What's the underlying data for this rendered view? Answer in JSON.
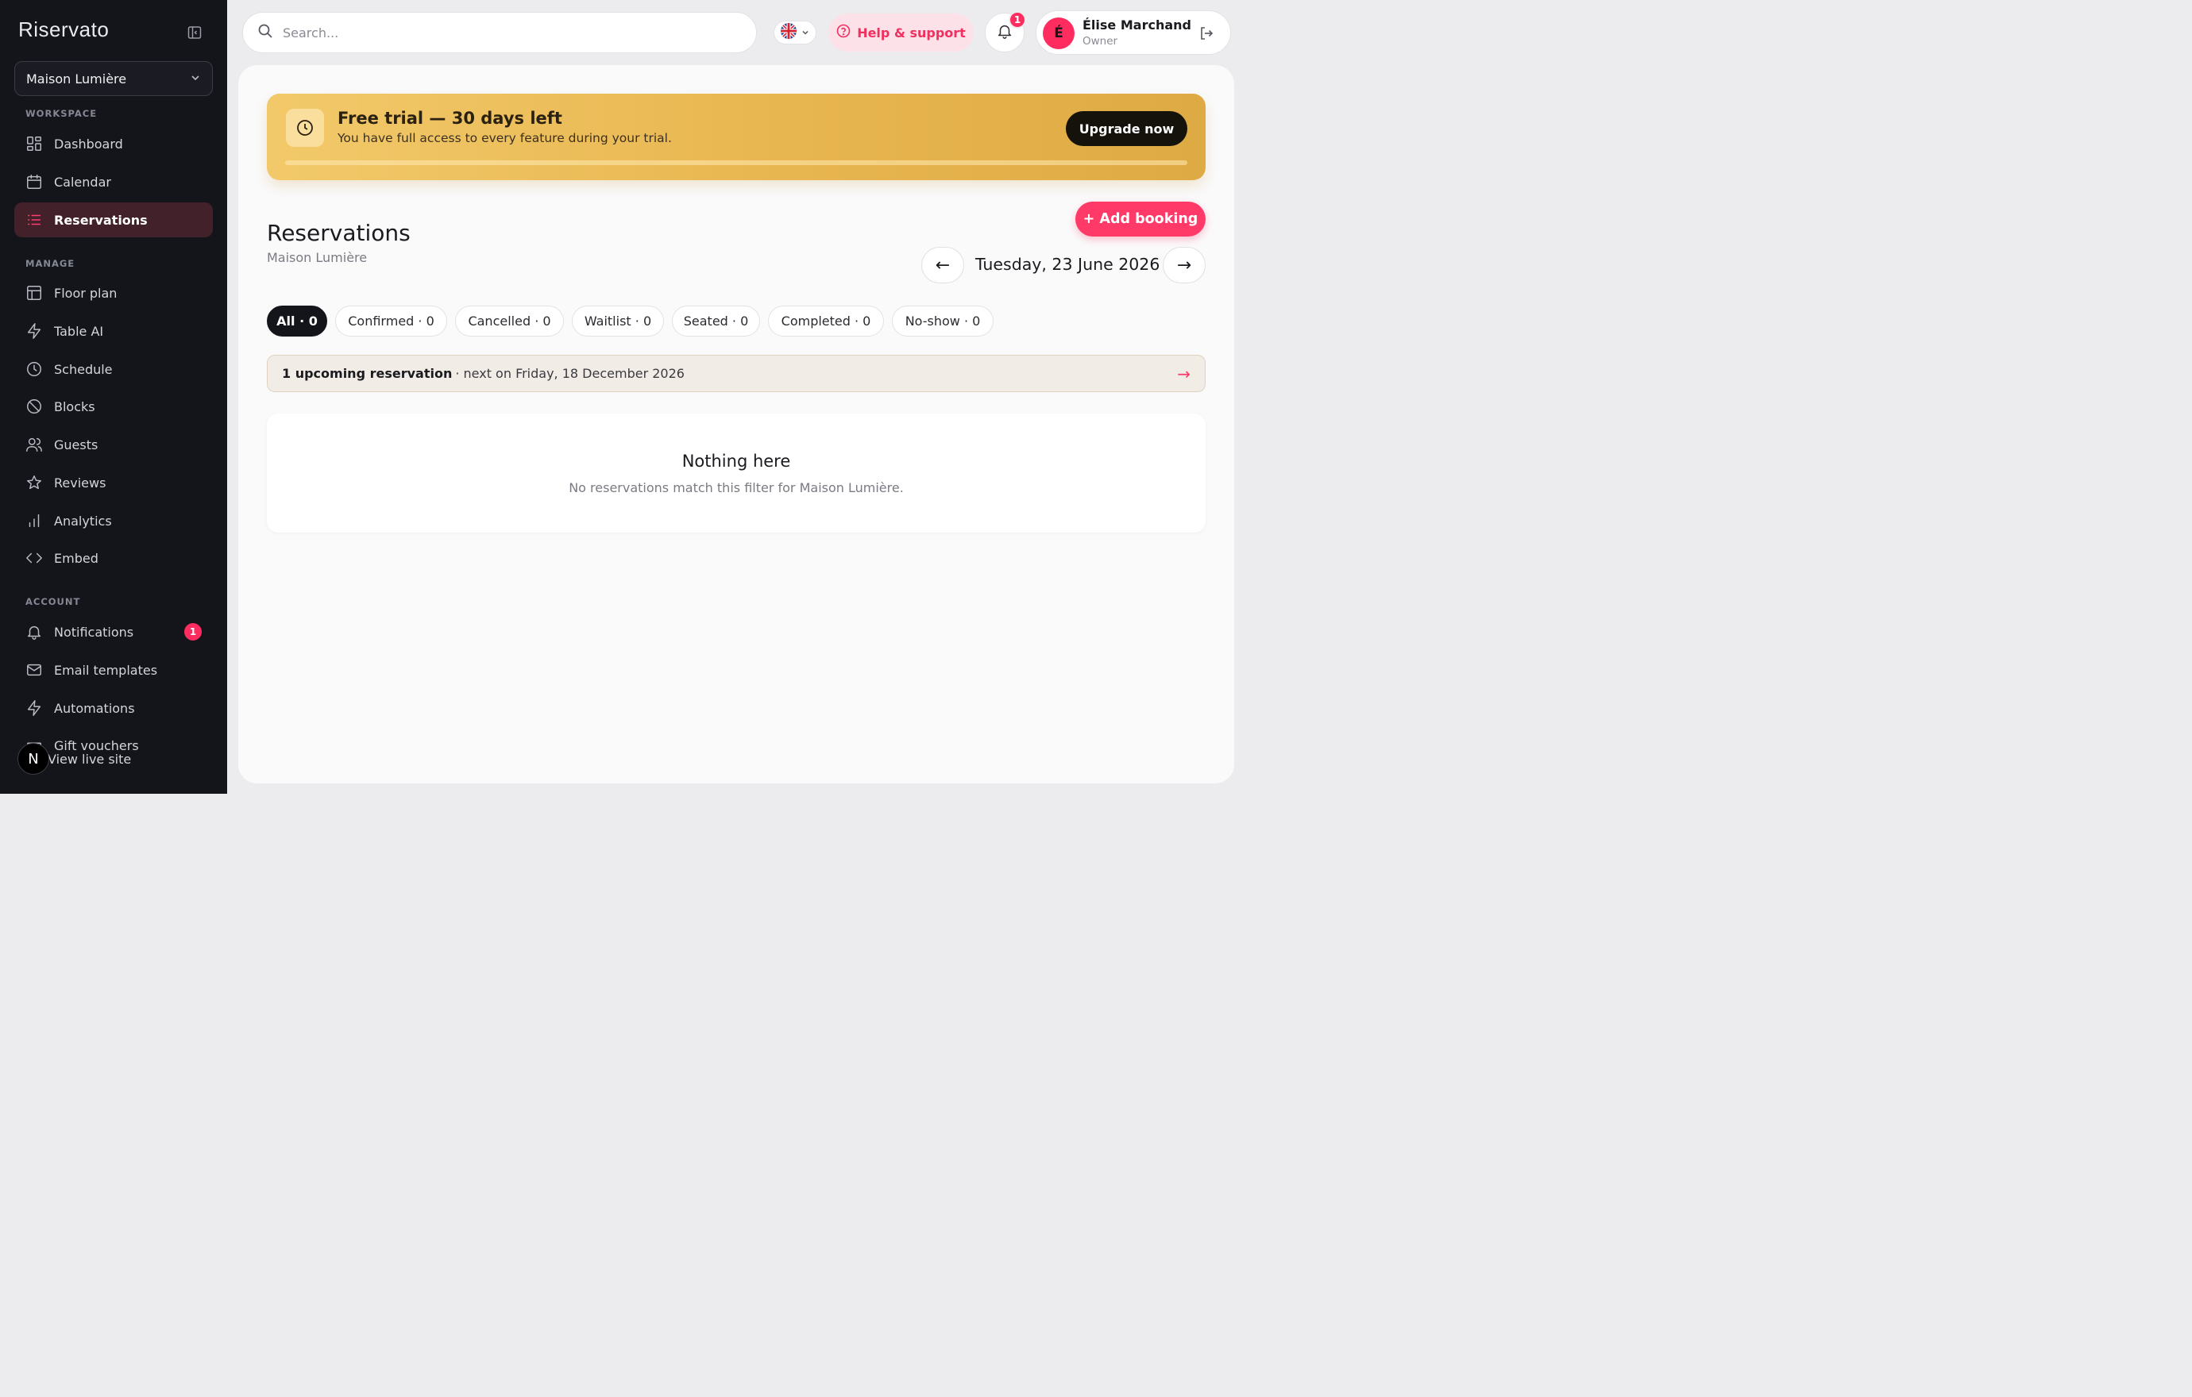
{
  "brand": {
    "name": "Riservato"
  },
  "venue_selector": {
    "value": "Maison Lumière"
  },
  "sidebar": {
    "sections": {
      "workspace": "WORKSPACE",
      "manage": "MANAGE",
      "account": "ACCOUNT"
    },
    "items": [
      {
        "label": "Dashboard",
        "icon": "grid-icon"
      },
      {
        "label": "Calendar",
        "icon": "calendar-icon"
      },
      {
        "label": "Reservations",
        "icon": "list-icon",
        "active": true
      },
      {
        "label": "Floor plan",
        "icon": "layout-icon"
      },
      {
        "label": "Table AI",
        "icon": "bolt-icon"
      },
      {
        "label": "Schedule",
        "icon": "clock-icon"
      },
      {
        "label": "Blocks",
        "icon": "ban-icon"
      },
      {
        "label": "Guests",
        "icon": "users-icon"
      },
      {
        "label": "Reviews",
        "icon": "star-icon"
      },
      {
        "label": "Analytics",
        "icon": "bar-chart-icon"
      },
      {
        "label": "Embed",
        "icon": "code-icon"
      },
      {
        "label": "Notifications",
        "icon": "bell-icon",
        "badge": "1"
      },
      {
        "label": "Email templates",
        "icon": "mail-icon"
      },
      {
        "label": "Automations",
        "icon": "bolt-icon"
      },
      {
        "label": "Gift vouchers",
        "icon": "gift-icon"
      }
    ],
    "live_site": {
      "label": "View live site",
      "badge_letter": "N"
    }
  },
  "topbar": {
    "search_placeholder": "Search...",
    "language": "EN",
    "help_label": "Help & support",
    "notifications_count": "1",
    "user": {
      "initial": "É",
      "name": "Élise Marchand",
      "role": "Owner"
    }
  },
  "trial": {
    "title": "Free trial — 30 days left",
    "subtitle": "You have full access to every feature during your trial.",
    "cta": "Upgrade now",
    "progress": 0
  },
  "page": {
    "title": "Reservations",
    "subtitle": "Maison Lumière",
    "add_booking": "+ Add booking",
    "date_label": "Tuesday, 23 June 2026",
    "prev": "←",
    "next": "→"
  },
  "filters": [
    {
      "label": "All · 0",
      "active": true
    },
    {
      "label": "Confirmed · 0"
    },
    {
      "label": "Cancelled · 0"
    },
    {
      "label": "Waitlist · 0"
    },
    {
      "label": "Seated · 0"
    },
    {
      "label": "Completed · 0"
    },
    {
      "label": "No-show · 0"
    }
  ],
  "upcoming": {
    "strong": "1 upcoming reservation",
    "rest": "· next on Friday, 18 December 2026",
    "arrow": "→"
  },
  "empty_state": {
    "title": "Nothing here",
    "subtitle": "No reservations match this filter for Maison Lumière."
  },
  "colors": {
    "accent": "#ff3a68",
    "sidebar_bg": "#14151b",
    "trial_gold": "#e8b650"
  }
}
